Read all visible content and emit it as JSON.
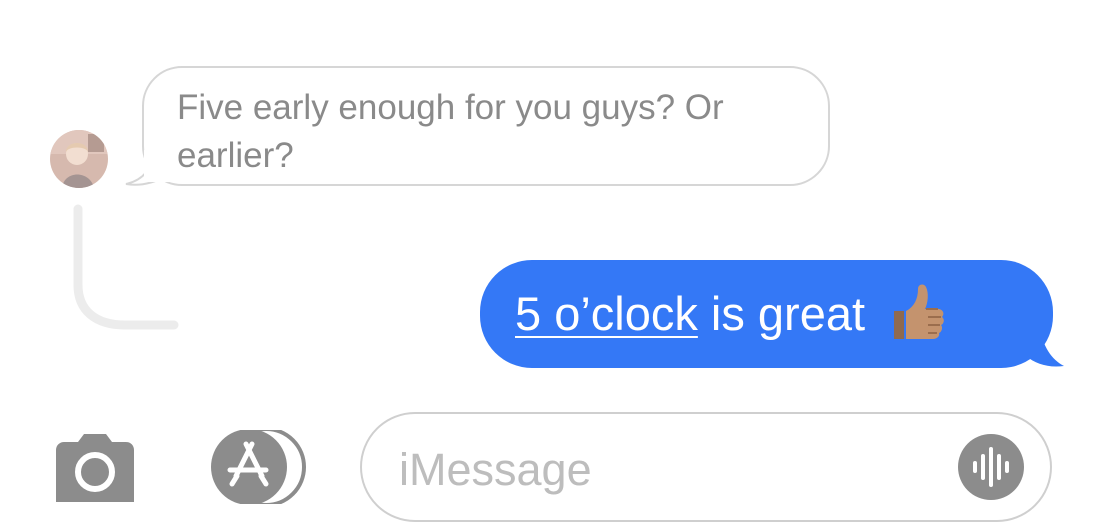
{
  "conversation": {
    "incoming_message": {
      "text_line1": "Five early enough for you guys? Or",
      "text_line2": "earlier?"
    },
    "outgoing_message": {
      "link_text": "5 o’clock",
      "rest_text": " is great",
      "emoji": "thumbs-up-icon"
    }
  },
  "composer": {
    "placeholder": "iMessage",
    "camera_icon": "camera-icon",
    "apps_icon": "app-store-icon",
    "audio_icon": "audio-waveform-icon"
  },
  "colors": {
    "sent_bubble": "#3478f6",
    "received_border": "#d6d6d6",
    "icon_gray": "#8c8c8c"
  }
}
